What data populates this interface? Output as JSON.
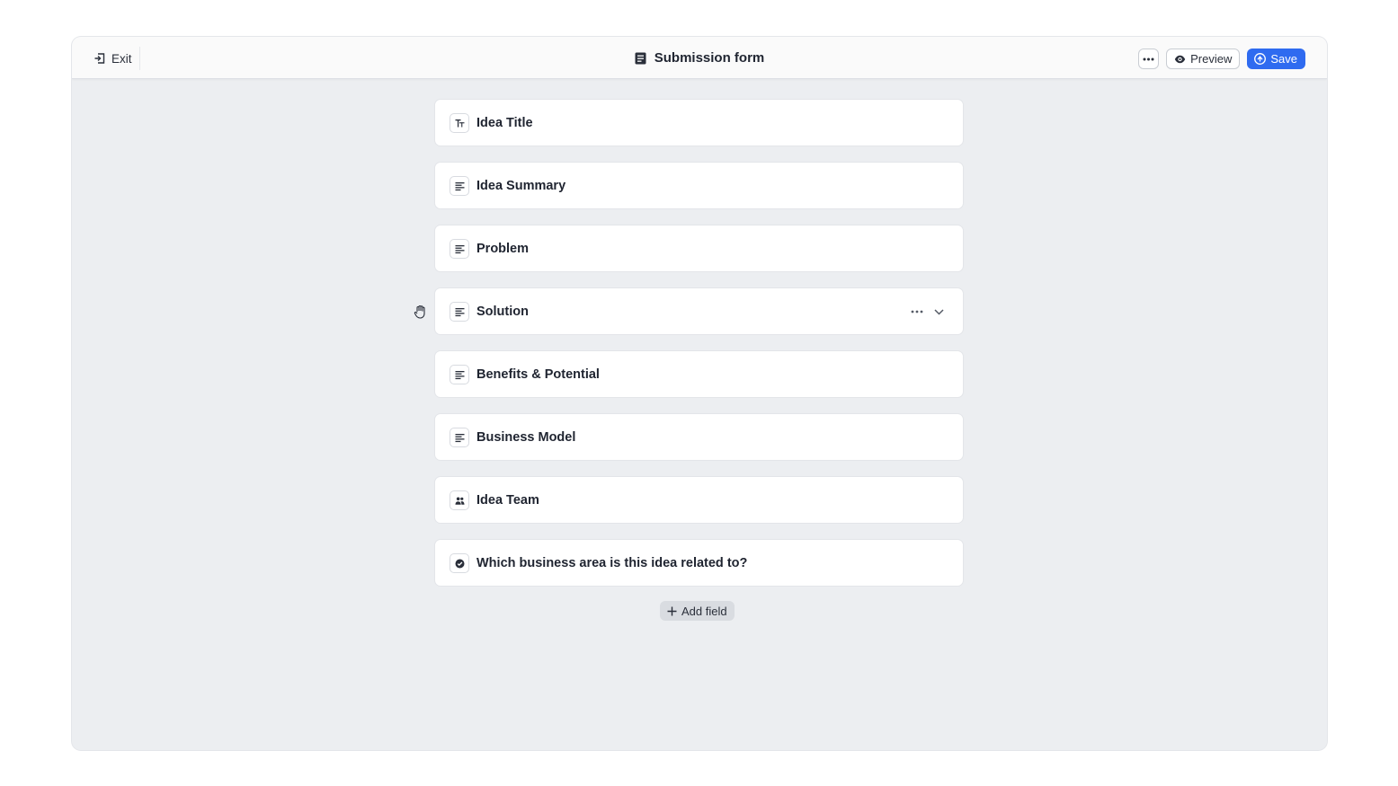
{
  "header": {
    "exit_label": "Exit",
    "title": "Submission form",
    "preview_label": "Preview",
    "save_label": "Save",
    "more_label": "•••"
  },
  "fields": [
    {
      "label": "Idea Title",
      "icon": "text-type-icon"
    },
    {
      "label": "Idea Summary",
      "icon": "paragraph-icon"
    },
    {
      "label": "Problem",
      "icon": "paragraph-icon"
    },
    {
      "label": "Solution",
      "icon": "paragraph-icon"
    },
    {
      "label": "Benefits & Potential",
      "icon": "paragraph-icon"
    },
    {
      "label": "Business Model",
      "icon": "paragraph-icon"
    },
    {
      "label": "Idea Team",
      "icon": "team-icon"
    },
    {
      "label": "Which business area is this idea related to?",
      "icon": "check-circle-icon"
    }
  ],
  "add_field_label": "Add field",
  "colors": {
    "accent": "#2f6bf0",
    "canvas": "#eceef1",
    "card": "#ffffff"
  }
}
